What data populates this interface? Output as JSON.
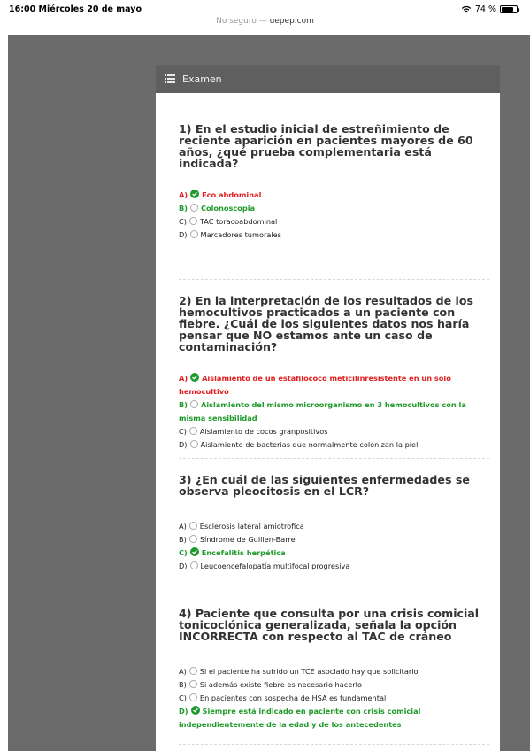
{
  "status_bar": {
    "time_date": "16:00  Miércoles 20 de mayo",
    "battery": "74 %",
    "url_prefix": "No seguro — ",
    "url_host": "uepep.com"
  },
  "header": {
    "title": "Examen"
  },
  "questions": [
    {
      "title": "1) En el estudio inicial de estreñimiento de reciente aparición en pacientes mayores de 60 años, ¿qué prueba complementaria está indicada?",
      "options": [
        {
          "letter": "A)",
          "text": "Eco abdominal",
          "state": "wrong",
          "marked": true
        },
        {
          "letter": "B)",
          "text": "Colonoscopia",
          "state": "correct",
          "marked": false
        },
        {
          "letter": "C)",
          "text": "TAC toracoabdominal",
          "state": "normal",
          "marked": false
        },
        {
          "letter": "D)",
          "text": "Marcadores tumorales",
          "state": "normal",
          "marked": false
        }
      ]
    },
    {
      "title": "2) En la interpretación de los resultados de los hemocultivos practicados a un paciente con fiebre. ¿Cuál de los siguientes datos nos haría pensar que NO estamos ante un caso de contaminación?",
      "options": [
        {
          "letter": "A)",
          "text": "Aislamiento de un estafilococo meticilinresistente en un solo hemocultivo",
          "state": "wrong",
          "marked": true
        },
        {
          "letter": "B)",
          "text": "Aislamiento del mismo microorganismo en 3 hemocultivos con la misma sensibilidad",
          "state": "correct",
          "marked": false
        },
        {
          "letter": "C)",
          "text": "Aislamiento de cocos granpositivos",
          "state": "normal",
          "marked": false
        },
        {
          "letter": "D)",
          "text": "Aislamiento de bacterias que normalmente colonizan la piel",
          "state": "normal",
          "marked": false
        }
      ]
    },
    {
      "title": "3) ¿En cuál de las siguientes enfermedades se observa pleocitosis en el LCR?",
      "options": [
        {
          "letter": "A)",
          "text": "Esclerosis lateral amiotrofica",
          "state": "normal",
          "marked": false
        },
        {
          "letter": "B)",
          "text": "Síndrome de Guillen-Barre",
          "state": "normal",
          "marked": false
        },
        {
          "letter": "C)",
          "text": "Encefalitis herpética",
          "state": "correct",
          "marked": true
        },
        {
          "letter": "D)",
          "text": "Leucoencefalopatía multifocal progresiva",
          "state": "normal",
          "marked": false
        }
      ]
    },
    {
      "title": "4) Paciente que consulta por una crisis comicial tonicoclónica generalizada, señala la opción INCORRECTA con respecto al TAC de cráneo",
      "options": [
        {
          "letter": "A)",
          "text": "Si el paciente ha sufrido un TCE asociado hay que solicitarlo",
          "state": "normal",
          "marked": false
        },
        {
          "letter": "B)",
          "text": "Si además existe fiebre es necesario hacerlo",
          "state": "normal",
          "marked": false
        },
        {
          "letter": "C)",
          "text": "En pacientes con sospecha de HSA es fundamental",
          "state": "normal",
          "marked": false
        },
        {
          "letter": "D)",
          "text": "Siempre está indicado en paciente con crisis comicial independientemente de la edad y de los antecedentes",
          "state": "correct",
          "marked": true
        }
      ]
    }
  ],
  "colors": {
    "correct": "#1f9a2a",
    "wrong": "#e02020",
    "header_bg": "#5f5f5f",
    "side_bg": "#6b6b6b"
  }
}
